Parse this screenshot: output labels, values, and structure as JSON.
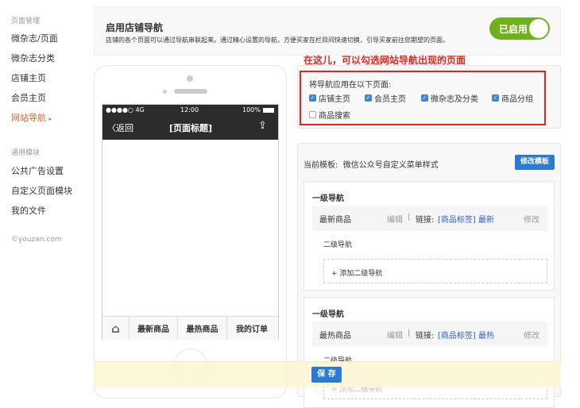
{
  "sidebar": {
    "section1": "页面管理",
    "items1": [
      "微杂志/页面",
      "微杂志分类",
      "店铺主页",
      "会员主页",
      "网站导航"
    ],
    "section2": "通用模块",
    "items2": [
      "公共广告设置",
      "自定义页面模块",
      "我的文件"
    ],
    "copyright": "©youzan.com"
  },
  "header": {
    "title": "启用店铺导航",
    "desc": "店铺的各个页面可以通过导航串联起来。通过精心设置的导航，方便买家在栏目间快速切换，引导买家前往您期望的页面。",
    "toggle_label": "已启用"
  },
  "phone": {
    "carrier": "●●●●○ 4G",
    "time": "12:00",
    "battery": "100%",
    "back": "返回",
    "title": "[页面标题]",
    "tabs": [
      "最新商品",
      "最热商品",
      "我的订单"
    ]
  },
  "annotation": "在这儿，可以勾选网站导航出现的页面",
  "apply": {
    "label": "将导航应用在以下页面:",
    "options": [
      {
        "label": "店铺主页",
        "checked": true
      },
      {
        "label": "会员主页",
        "checked": true
      },
      {
        "label": "微杂志及分类",
        "checked": true
      },
      {
        "label": "商品分组",
        "checked": true
      },
      {
        "label": "商品搜索",
        "checked": false
      }
    ]
  },
  "template": {
    "label": "当前模板:",
    "name": "微信公众号自定义菜单样式",
    "button": "修改模板"
  },
  "navs": [
    {
      "heading": "一级导航",
      "name": "最新商品",
      "edit": "编辑",
      "sep": "|",
      "link_label": "链接:",
      "link": "[商品标签] 最新",
      "modify": "修改",
      "sub_heading": "二级导航",
      "add_sub": "+ 添加二级导航"
    },
    {
      "heading": "一级导航",
      "name": "最热商品",
      "edit": "编辑",
      "sep": "|",
      "link_label": "链接:",
      "link": "[商品标签] 最热",
      "modify": "修改",
      "sub_heading": "二级导航",
      "add_sub": "+ 添加二级导航"
    }
  ],
  "save": "保 存"
}
